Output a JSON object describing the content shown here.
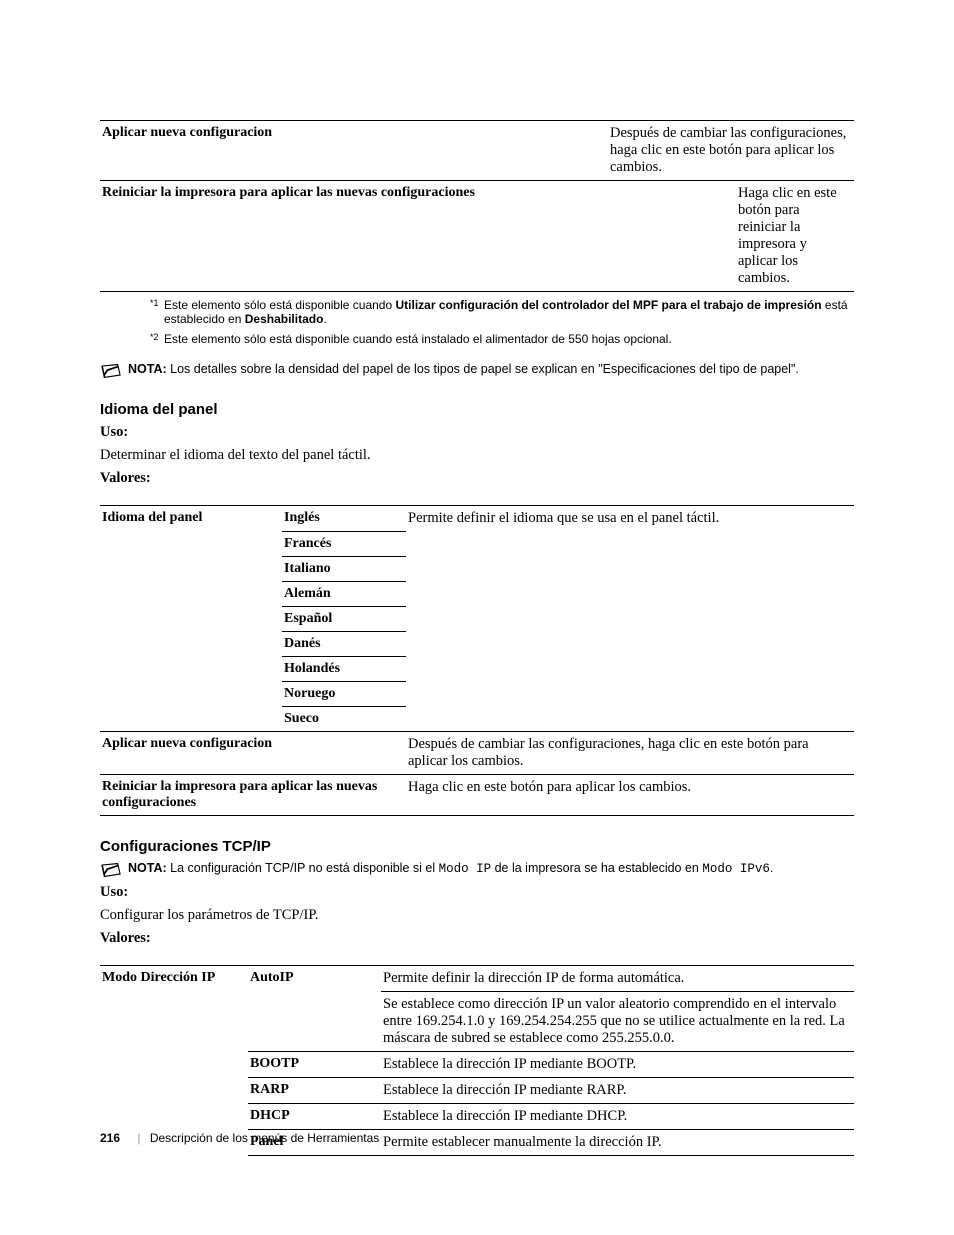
{
  "table1": {
    "rows": [
      {
        "label": "Aplicar nueva configuracion",
        "desc": "Después de cambiar las configuraciones, haga clic en este botón para aplicar los cambios."
      },
      {
        "label": "Reiniciar la impresora para aplicar las nuevas configuraciones",
        "desc": "Haga clic en este botón para reiniciar la impresora y aplicar los cambios."
      }
    ]
  },
  "footnotes": {
    "f1_prefix": "Este elemento sólo está disponible cuando ",
    "f1_bold": "Utilizar configuración del controlador del MPF para el trabajo de impresión",
    "f1_mid": " está establecido en ",
    "f1_bold2": "Deshabilitado",
    "f1_suffix": ".",
    "f2": "Este elemento sólo está disponible cuando está instalado el alimentador de 550 hojas opcional."
  },
  "note1": {
    "label": "NOTA:",
    "text": " Los detalles sobre la densidad del papel de los tipos de papel se explican en \"Especificaciones del tipo de papel\"."
  },
  "idioma": {
    "heading": "Idioma del panel",
    "uso_label": "Uso:",
    "uso_desc": "Determinar el idioma del texto del panel táctil.",
    "valores_label": "Valores:",
    "row_label": "Idioma del panel",
    "row_desc": "Permite definir el idioma que se usa en el panel táctil.",
    "langs": [
      "Inglés",
      "Francés",
      "Italiano",
      "Alemán",
      "Español",
      "Danés",
      "Holandés",
      "Noruego",
      "Sueco"
    ],
    "apply_label": "Aplicar nueva configuracion",
    "apply_desc": "Después de cambiar las configuraciones, haga clic en este botón para aplicar los cambios.",
    "restart_label": "Reiniciar la impresora para aplicar las nuevas configuraciones",
    "restart_desc": "Haga clic en este botón para aplicar los cambios."
  },
  "tcpip": {
    "heading": "Configuraciones TCP/IP",
    "note_label": "NOTA:",
    "note_text1": " La configuración TCP/IP no está disponible si el ",
    "note_mono1": "Modo IP",
    "note_text2": " de la impresora se ha establecido en ",
    "note_mono2": "Modo IPv6",
    "note_text3": ".",
    "uso_label": "Uso:",
    "uso_desc": "Configurar los parámetros de TCP/IP.",
    "valores_label": "Valores:",
    "row_label": "Modo Dirección IP",
    "modes": [
      {
        "label": "AutoIP",
        "desc1": "Permite definir la dirección IP de forma automática.",
        "desc2": "Se establece como dirección IP un valor aleatorio comprendido en el intervalo entre 169.254.1.0 y 169.254.254.255 que no se utilice actualmente en la red. La máscara de subred se establece como 255.255.0.0."
      },
      {
        "label": "BOOTP",
        "desc1": "Establece la dirección IP mediante BOOTP."
      },
      {
        "label": "RARP",
        "desc1": "Establece la dirección IP mediante RARP."
      },
      {
        "label": "DHCP",
        "desc1": "Establece la dirección IP mediante DHCP."
      },
      {
        "label": "Panel",
        "desc1": "Permite establecer manualmente la dirección IP."
      }
    ]
  },
  "footer": {
    "page": "216",
    "title": "Descripción de los menús de Herramientas"
  }
}
